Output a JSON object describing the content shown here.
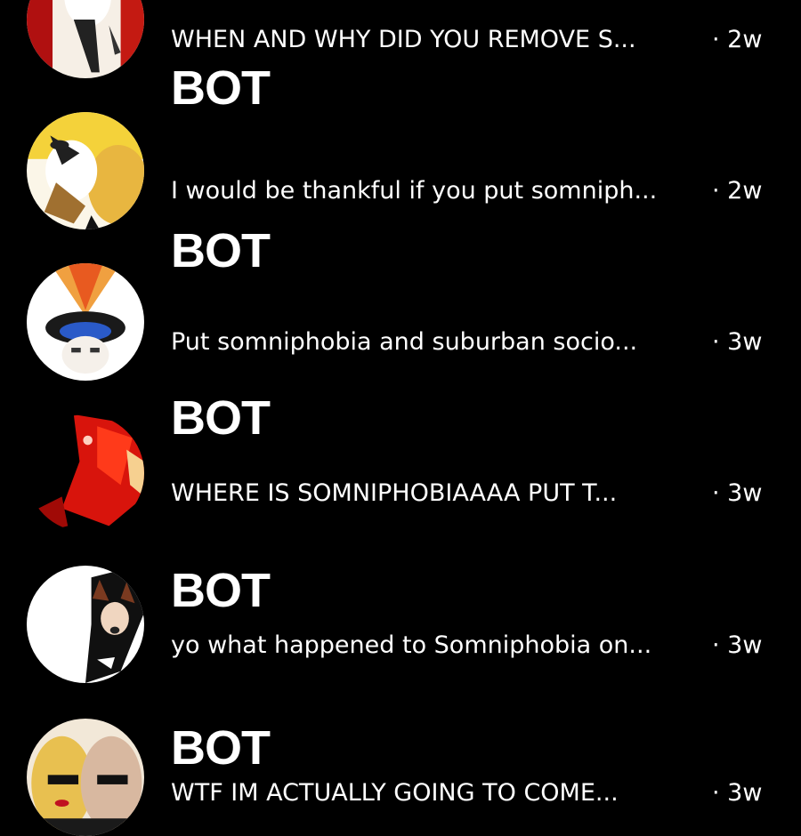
{
  "colors": {
    "background": "#000000",
    "text": "#ffffff"
  },
  "conversations": [
    {
      "name": "",
      "preview": "WHEN AND WHY DID YOU REMOVE S...",
      "time": "· 2w",
      "avatar": "avatar-photo"
    },
    {
      "name": "BOT",
      "preview": "I would be thankful if you put somniph...",
      "time": "· 2w",
      "avatar": "avatar-photo"
    },
    {
      "name": "BOT",
      "preview": "Put somniphobia and suburban socio...",
      "time": "· 3w",
      "avatar": "avatar-photo"
    },
    {
      "name": "BOT",
      "preview": "WHERE IS SOMNIPHOBIAAAA PUT T...",
      "time": "· 3w",
      "avatar": "avatar-photo"
    },
    {
      "name": "BOT",
      "preview": "yo what happened to Somniphobia on...",
      "time": "· 3w",
      "avatar": "avatar-photo"
    },
    {
      "name": "BOT",
      "preview": "WTF IM ACTUALLY GOING TO COME...",
      "time": "· 3w",
      "avatar": "avatar-photo"
    }
  ]
}
